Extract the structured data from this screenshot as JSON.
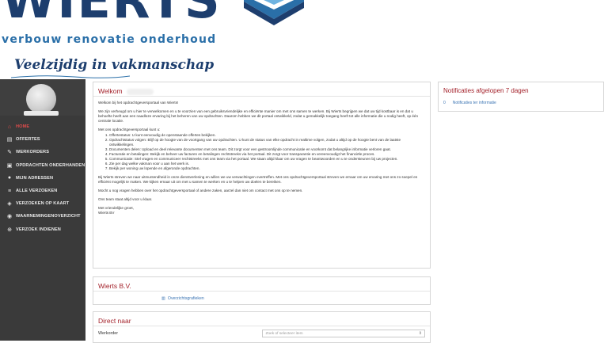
{
  "header": {
    "logo_text": "WIERTS",
    "tagline": "verbouw renovatie onderhoud",
    "slogan": "Veelzijdig in vakmanschap"
  },
  "sidebar": {
    "items": [
      {
        "label": "HOME",
        "icon": "home-icon",
        "glyph": "⌂",
        "active": true
      },
      {
        "label": "OFFERTES",
        "icon": "document-icon",
        "glyph": "▤",
        "active": false
      },
      {
        "label": "WERKORDERS",
        "icon": "tools-icon",
        "glyph": "✎",
        "active": false
      },
      {
        "label": "OPDRACHTEN ONDERHANDEN",
        "icon": "clipboard-icon",
        "glyph": "▣",
        "active": false
      },
      {
        "label": "MIJN ADRESSEN",
        "icon": "map-marker-icon",
        "glyph": "●",
        "active": false
      },
      {
        "label": "ALLE VERZOEKEN",
        "icon": "list-icon",
        "glyph": "≡",
        "active": false
      },
      {
        "label": "VERZOEKEN OP KAART",
        "icon": "map-icon",
        "glyph": "◈",
        "active": false
      },
      {
        "label": "WAARNEMINGENOVERZICHT",
        "icon": "eye-icon",
        "glyph": "◉",
        "active": false
      },
      {
        "label": "VERZOEK INDIENEN",
        "icon": "plus-circle-icon",
        "glyph": "⊕",
        "active": false
      }
    ]
  },
  "welcome": {
    "title": "Welkom",
    "intro": "Welkom bij het opdrachtgeversportaal van Wierts!",
    "p1": "We zijn verheugd om u hier te verwelkomen en u te voorzien van een gebruiksvriendelijke en efficiënte manier om met ons samen te werken. Bij Wierts begrijpen we dat uw tijd kostbaar is en dat u behoefte heeft aan een naadloze ervaring bij het beheren van uw opdrachten. Daarom hebben we dit portaal ontwikkeld, zodat u gemakkelijk toegang heeft tot alle informatie die u nodig heeft, op één centrale locatie.",
    "list_intro": "Met ons opdrachtgeversportaal kunt u:",
    "list": [
      "Offertestatus: U kunt eenvoudig de openstaande offertes bekijken.",
      "Opdrachtstatus volgen: Blijf op de hoogte van de voortgang van uw opdrachten. U kunt de status van elke opdracht in realtime volgen, zodat u altijd op de hoogte bent van de laatste ontwikkelingen.",
      "Documenten delen: Upload en deel relevante documenten met ons team. Dit zorgt voor een gestroomlijnde communicatie en voorkomt dat belangrijke informatie verloren gaat.",
      "Facturatie en betalingen: Bekijk en beheer uw facturen en betalingen rechtstreeks via het portaal. Dit zorgt voor transparantie en vereenvoudigt het financiële proces.",
      "Communicatie: Stel vragen en communiceer rechtstreeks met ons team via het portaal. We staan altijd klaar om uw vragen te beantwoorden en u te ondersteunen bij uw projecten.",
      "Zie per dag welke vakman voor u aan het werk is.",
      "Bekijk per woning uw lopende en afgeronde opdrachten."
    ],
    "p2": "Bij Wierts streven we naar uitmuntendheid in onze dienstverlening en willen we uw verwachtingen overtreffen. Met ons opdrachtgeversportaal streven we ernaar om uw ervaring met ons zo soepel en efficiënt mogelijk te maken. We kijken ernaar uit om met u samen te werken en u te helpen uw doelen te bereiken.",
    "p3": "Mocht u nog vragen hebben over het opdrachtgeversportaal of andere zaken, aarzel dan niet om contact met ons op te nemen.",
    "p4": "Ons team staat altijd voor u klaar.",
    "closing": "Met vriendelijke groet,",
    "signature": "Wierts BV"
  },
  "notifications": {
    "title": "Notificaties afgelopen 7 dagen",
    "count": "0",
    "label": "Notificaties ter informatie"
  },
  "company": {
    "title": "Wierts B.V.",
    "link": "Overzichtsgrafieken"
  },
  "direct": {
    "title": "Direct naar",
    "field_label": "Werkorder",
    "placeholder": "Zoek of selecteer item"
  },
  "colors": {
    "sidebar_bg": "#3a3a3a",
    "accent_red": "#a3212a",
    "active_red": "#e14b4b",
    "link_blue": "#3b74b3",
    "brand_navy": "#1d3e6e"
  }
}
